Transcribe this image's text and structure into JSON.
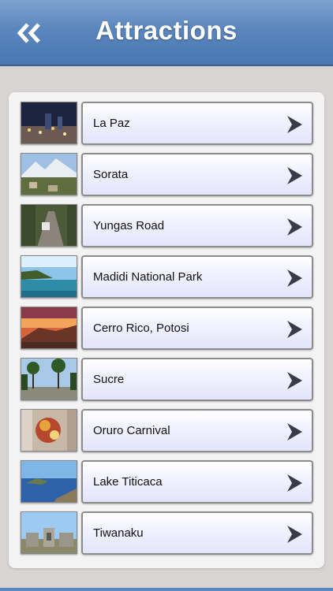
{
  "header": {
    "title": "Attractions",
    "back_icon": "double-chevron-left-icon"
  },
  "attractions": [
    {
      "label": "La Paz",
      "image": "city-night"
    },
    {
      "label": "Sorata",
      "image": "mountain-town"
    },
    {
      "label": "Yungas Road",
      "image": "forest-road"
    },
    {
      "label": "Madidi National Park",
      "image": "river-landscape"
    },
    {
      "label": "Cerro Rico, Potosi",
      "image": "sunset-hill"
    },
    {
      "label": "Sucre",
      "image": "palm-plaza"
    },
    {
      "label": "Oruro Carnival",
      "image": "carnival-costume"
    },
    {
      "label": "Lake Titicaca",
      "image": "lake-island"
    },
    {
      "label": "Tiwanaku",
      "image": "stone-ruins"
    }
  ],
  "colors": {
    "nav_bar": "#5b86bd",
    "background": "#d9d4d4",
    "row_fill": "#f2f2ff",
    "arrow": "#3a3a4a"
  }
}
